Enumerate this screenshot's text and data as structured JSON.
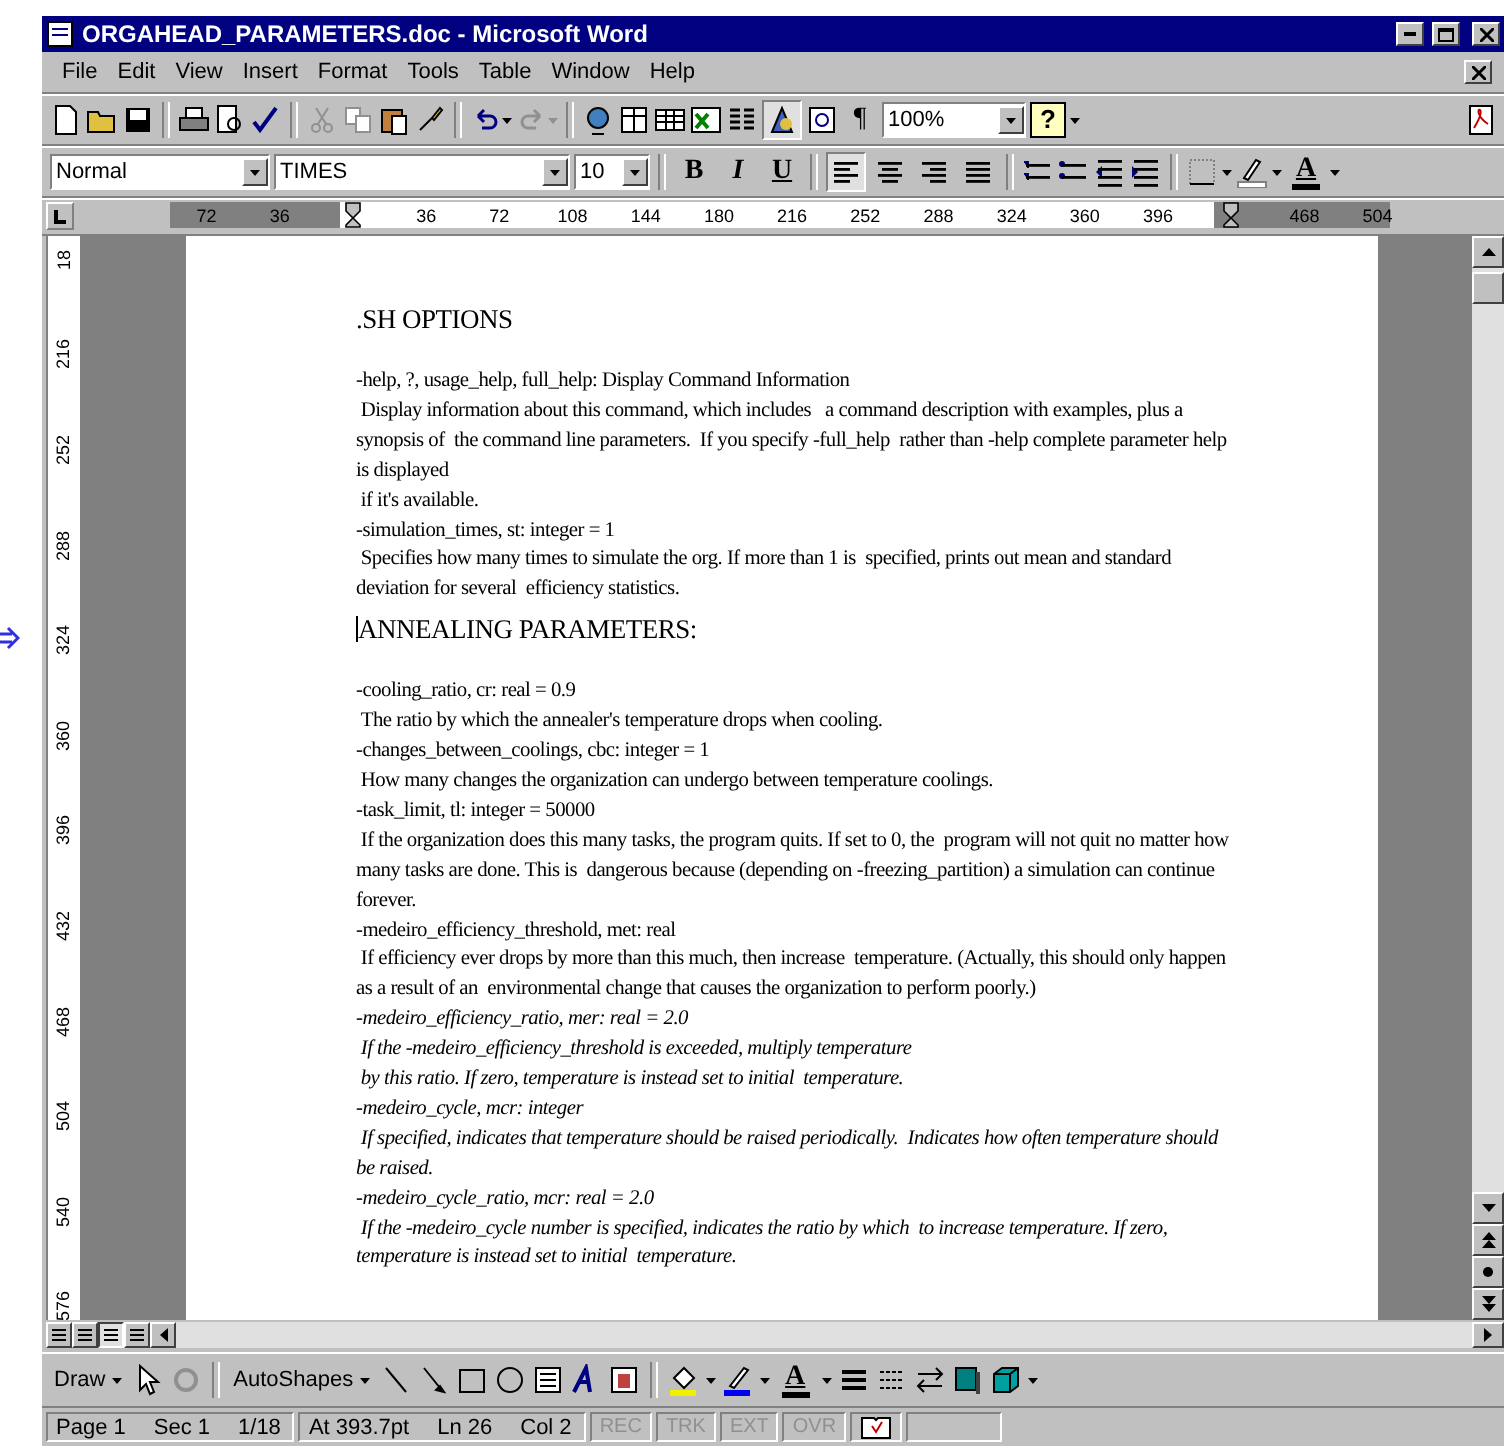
{
  "window": {
    "title": "ORGAHEAD_PARAMETERS.doc - Microsoft Word"
  },
  "menu": [
    "File",
    "Edit",
    "View",
    "Insert",
    "Format",
    "Tools",
    "Table",
    "Window",
    "Help"
  ],
  "standard_toolbar": {
    "drawing_toolbar_shown": true,
    "paragraph_mark": "¶",
    "zoom": "100%",
    "help_label": "?"
  },
  "formatting_toolbar": {
    "style": "Normal",
    "font": "TIMES",
    "size": "10",
    "text_buttons": [
      {
        "label": "B",
        "pressed": false
      },
      {
        "label": "I",
        "pressed": false
      },
      {
        "label": "U",
        "pressed": false
      }
    ],
    "alignment": [
      {
        "selected": true
      },
      {
        "selected": false
      },
      {
        "selected": false
      },
      {
        "selected": false
      }
    ],
    "font_color_label": "A"
  },
  "horizontal_ruler": [
    {
      "kind": "label",
      "text": "72"
    },
    {
      "kind": "label",
      "text": "36"
    },
    {
      "kind": "margin"
    },
    {
      "kind": "label",
      "text": "36"
    },
    {
      "kind": "label",
      "text": "72"
    },
    {
      "kind": "label",
      "text": "108"
    },
    {
      "kind": "label",
      "text": "144"
    },
    {
      "kind": "label",
      "text": "180"
    },
    {
      "kind": "label",
      "text": "216"
    },
    {
      "kind": "label",
      "text": "252"
    },
    {
      "kind": "label",
      "text": "288"
    },
    {
      "kind": "label",
      "text": "324"
    },
    {
      "kind": "label",
      "text": "360"
    },
    {
      "kind": "label",
      "text": "396"
    },
    {
      "kind": "margin"
    },
    {
      "kind": "label",
      "text": "468"
    },
    {
      "kind": "label",
      "text": "504"
    }
  ],
  "vertical_ruler": [
    "18",
    "216",
    "252",
    "288",
    "324",
    "360",
    "396",
    "432",
    "468",
    "504",
    "540",
    "576"
  ],
  "document": [
    {
      "kind": "heading",
      "text": ".SH OPTIONS"
    },
    {
      "kind": "text",
      "text": "-help, ?, usage_help, full_help: Display Command Information"
    },
    {
      "kind": "text",
      "text": " Display information about this command, which includes   a command description with examples, plus a synopsis of  the command line parameters.  If you specify -full_help  rather than -help complete parameter help is displayed"
    },
    {
      "kind": "text",
      "text": " if it's available."
    },
    {
      "kind": "text",
      "text": "-simulation_times, st: integer = 1"
    },
    {
      "kind": "text",
      "text": " Specifies how many times to simulate the org. If more than 1 is  specified, prints out mean and standard deviation for several  efficiency statistics."
    },
    {
      "kind": "heading",
      "text": "ANNEALING PARAMETERS:",
      "caret": true
    },
    {
      "kind": "text",
      "text": "-cooling_ratio, cr: real = 0.9"
    },
    {
      "kind": "text",
      "text": " The ratio by which the annealer's temperature drops when cooling."
    },
    {
      "kind": "text",
      "text": "-changes_between_coolings, cbc: integer = 1"
    },
    {
      "kind": "text",
      "text": " How many changes the organization can undergo between temperature coolings."
    },
    {
      "kind": "text",
      "text": "-task_limit, tl: integer = 50000"
    },
    {
      "kind": "text",
      "text": " If the organization does this many tasks, the program quits. If set to 0, the  program will not quit no matter how many tasks are done. This is  dangerous because (depending on -freezing_partition) a simulation can continue forever."
    },
    {
      "kind": "text",
      "text": "-medeiro_efficiency_threshold, met: real"
    },
    {
      "kind": "text",
      "text": " If efficiency ever drops by more than this much, then increase  temperature. (Actually, this should only happen as a result of an  environmental change that causes the organization to perform poorly.)"
    },
    {
      "kind": "italic",
      "text": "-medeiro_efficiency_ratio, mer: real = 2.0"
    },
    {
      "kind": "italic",
      "text": " If the -medeiro_efficiency_threshold is exceeded, multiply temperature"
    },
    {
      "kind": "italic",
      "text": " by this ratio. If zero, temperature is instead set to initial  temperature."
    },
    {
      "kind": "italic",
      "text": "-medeiro_cycle, mcr: integer"
    },
    {
      "kind": "italic",
      "text": " If specified, indicates that temperature should be raised periodically.  Indicates how often temperature should be raised."
    },
    {
      "kind": "italic",
      "text": "-medeiro_cycle_ratio, mcr: real = 2.0"
    },
    {
      "kind": "italic",
      "text": " If the -medeiro_cycle number is specified, indicates the ratio by which  to increase temperature. If zero, temperature is instead set to initial  temperature."
    }
  ],
  "view_buttons": [
    {
      "selected": false
    },
    {
      "selected": false
    },
    {
      "selected": true
    },
    {
      "selected": false
    }
  ],
  "drawing_toolbar": {
    "draw": "Draw",
    "autoshapes": "AutoShapes",
    "font_color_label": "A"
  },
  "status_bar": {
    "page": "Page 1",
    "section": "Sec 1",
    "pages": "1/18",
    "at": "At 393.7pt",
    "line": "Ln 26",
    "column": "Col 2",
    "modes": [
      {
        "label": "REC",
        "active": false
      },
      {
        "label": "TRK",
        "active": false
      },
      {
        "label": "EXT",
        "active": false
      },
      {
        "label": "OVR",
        "active": false
      }
    ]
  }
}
